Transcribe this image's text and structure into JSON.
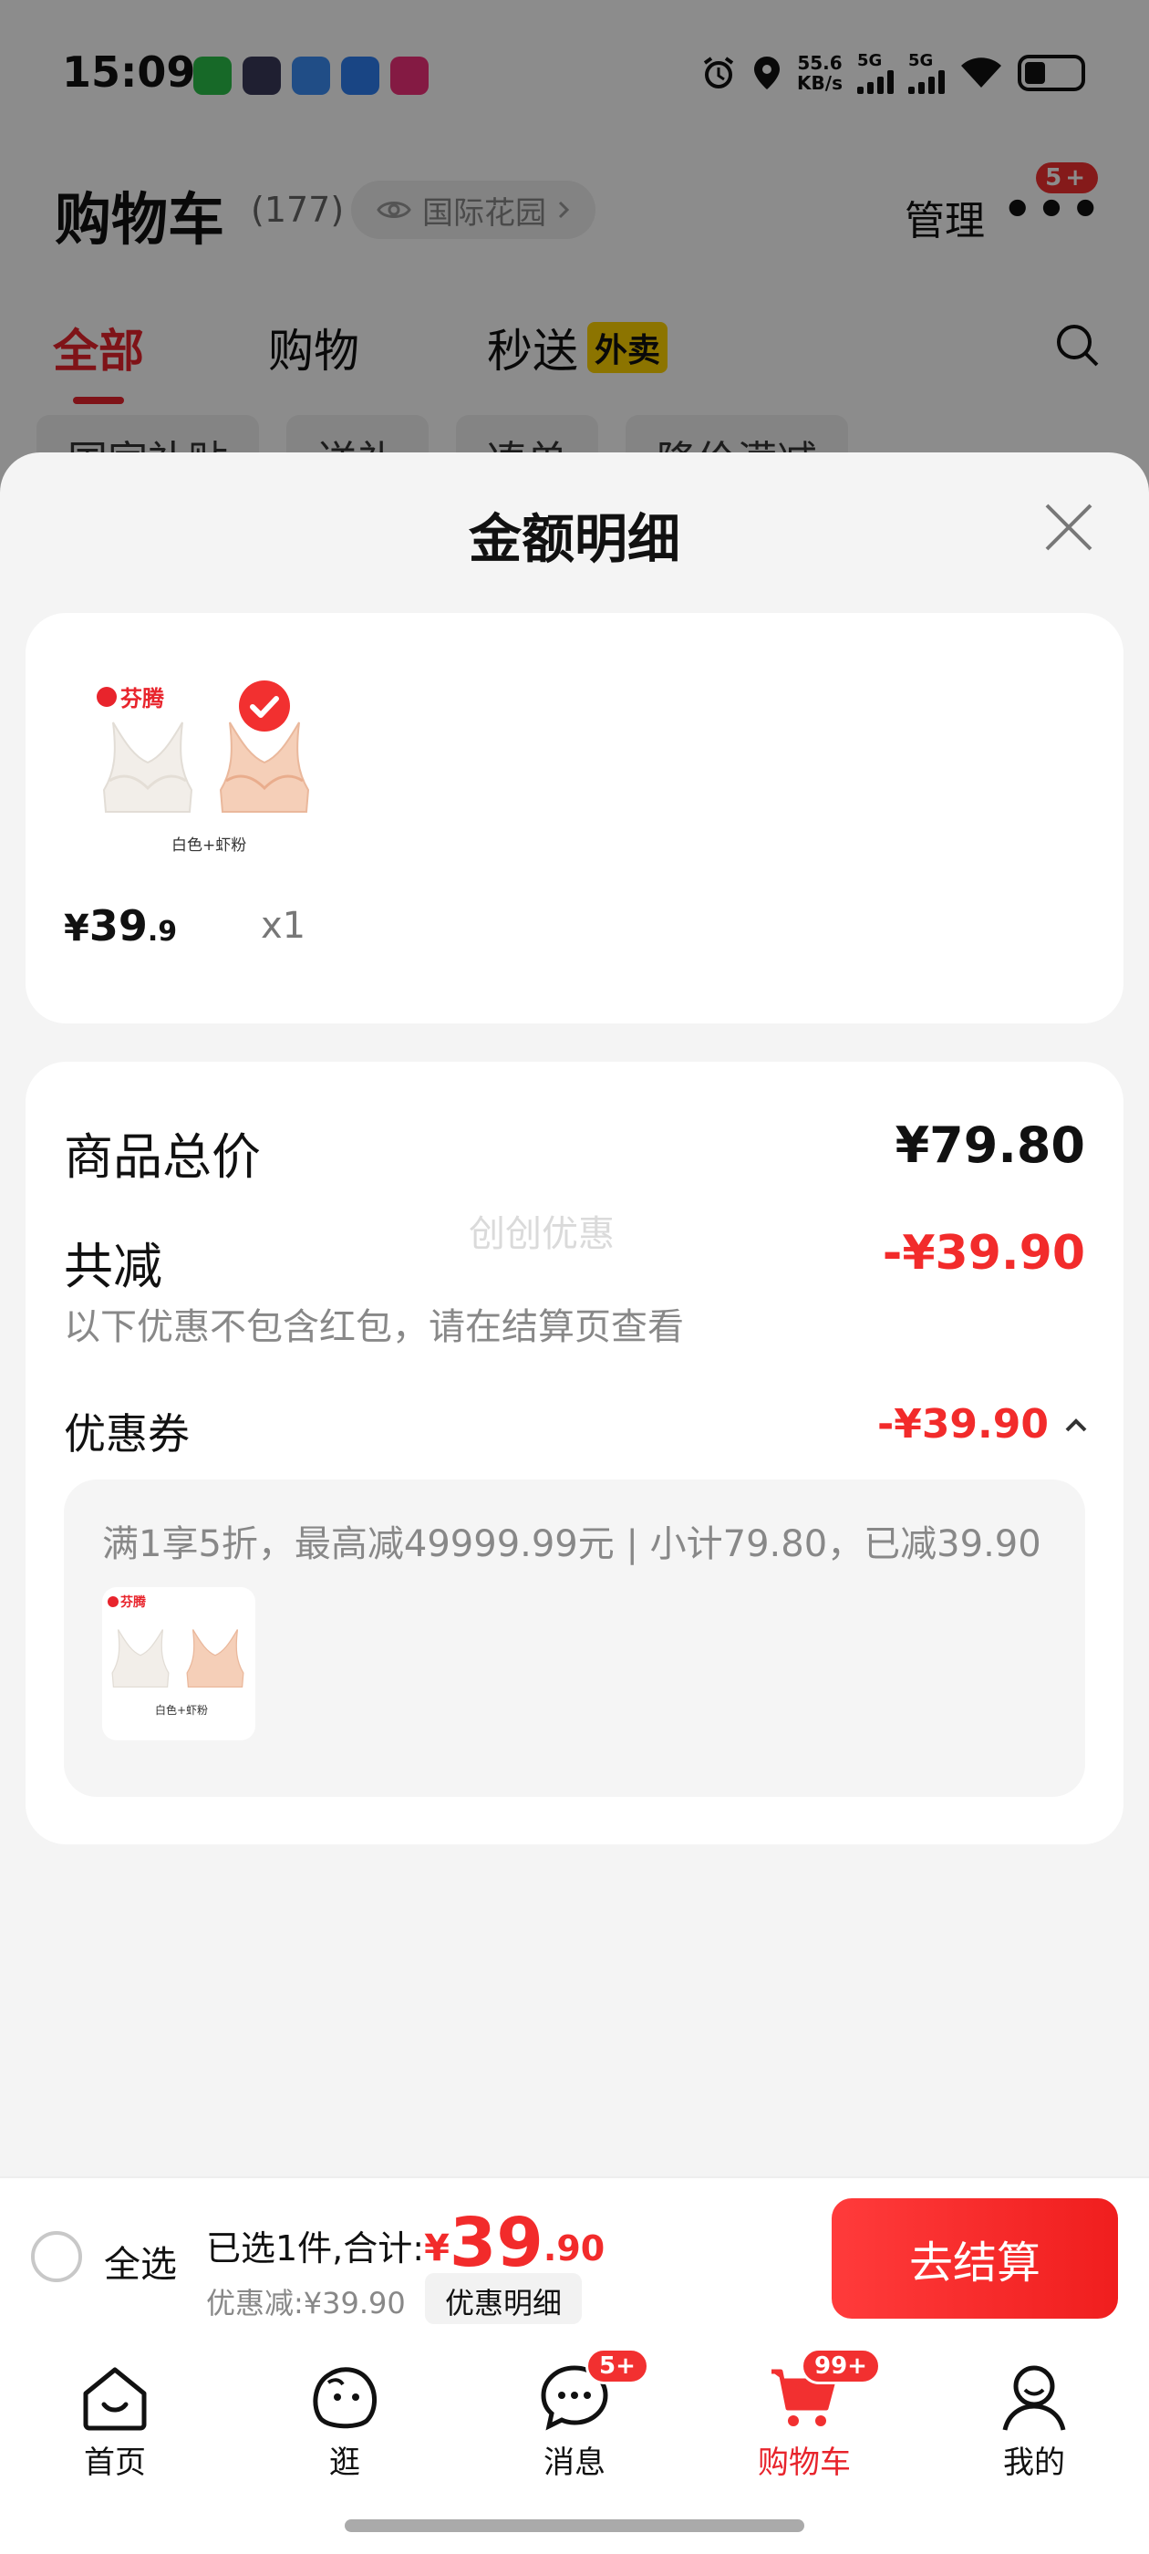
{
  "status_bar": {
    "time": "15:09",
    "net_speed_value": "55.6",
    "net_speed_unit": "KB/s",
    "sim1": "5G",
    "sim2": "5G"
  },
  "cart_header": {
    "title": "购物车",
    "count": "(177)",
    "location": "国际花园",
    "manage_label": "管理",
    "more_badge": "5+"
  },
  "tabs": [
    {
      "label": "全部",
      "active": true
    },
    {
      "label": "购物",
      "active": false
    },
    {
      "label": "秒送",
      "badge": "外卖",
      "active": false
    }
  ],
  "filter_chips": [
    "国家补贴",
    "送礼",
    "凑单",
    "降价满减"
  ],
  "modal": {
    "title": "金额明细",
    "product": {
      "brand": "芬腾",
      "variant": "白色+虾粉",
      "price_yen": "¥",
      "price_int": "39",
      "price_dec": ".9",
      "quantity": "x1"
    },
    "watermark": "创创优惠",
    "total_label": "商品总价",
    "total_value": "¥79.80",
    "reduce_label": "共减",
    "reduce_value": "-¥39.90",
    "reduce_note": "以下优惠不包含红包，请在结算页查看",
    "coupon_label": "优惠券",
    "coupon_value": "-¥39.90",
    "coupon_desc": "满1享5折，最高减49999.99元 | 小计79.80，已减39.90"
  },
  "checkout_bar": {
    "select_all": "全选",
    "selected_prefix": "已选1件,合计:",
    "total_yen": "¥",
    "total_int": "39",
    "total_dec": ".90",
    "discount": "优惠减:¥39.90",
    "detail_chip": "优惠明细",
    "checkout_button": "去结算"
  },
  "bottom_nav": [
    {
      "label": "首页",
      "icon": "home-icon"
    },
    {
      "label": "逛",
      "icon": "browse-icon"
    },
    {
      "label": "消息",
      "icon": "message-icon",
      "badge": "5+"
    },
    {
      "label": "购物车",
      "icon": "cart-icon",
      "badge": "99+",
      "active": true
    },
    {
      "label": "我的",
      "icon": "profile-icon"
    }
  ],
  "colors": {
    "accent": "#e8242c",
    "price_red": "#f22b2b",
    "sheet_bg": "#f4f4f4"
  }
}
